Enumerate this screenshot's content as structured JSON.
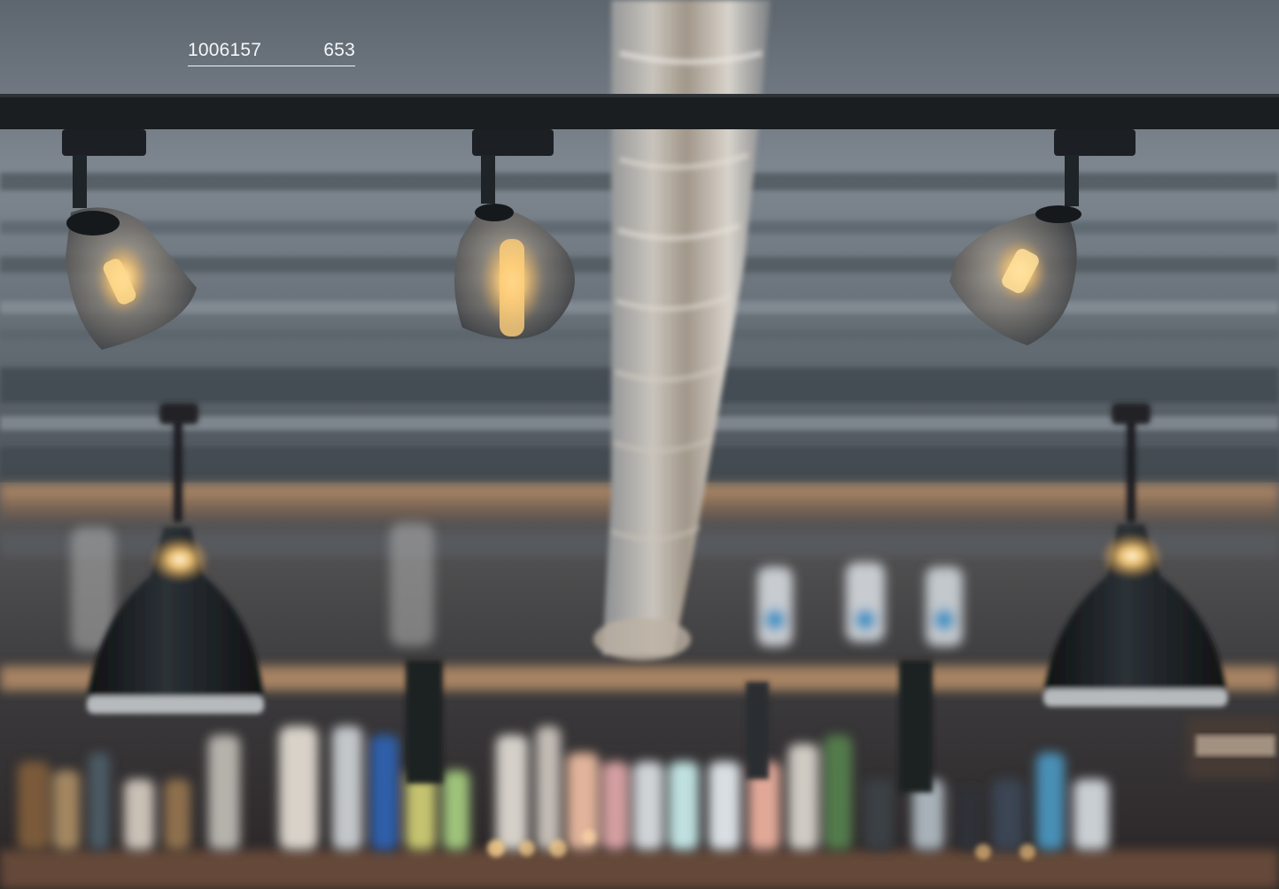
{
  "caption": {
    "article_number": "1006157",
    "code": "653"
  },
  "colors": {
    "ceiling": "#6e7780",
    "rail": "#1a1e21",
    "warm_light": "#ffd58a",
    "shade_black": "#141719",
    "caption_text": "#f4f6f7"
  },
  "scene": {
    "subject": "track-spotlights-over-bar",
    "icons": [
      "spotlight-icon",
      "pendant-lamp-icon",
      "bottle-icon"
    ]
  }
}
